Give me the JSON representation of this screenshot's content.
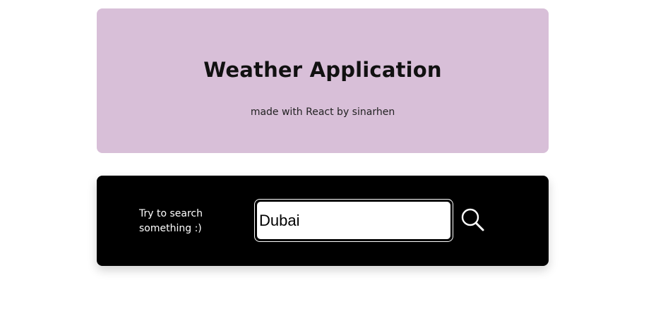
{
  "header": {
    "title": "Weather Application",
    "subtitle": "made with React by sinarhen",
    "background_color": "#d8bfd8"
  },
  "search": {
    "hint": "Try to search something :)",
    "input_value": "Dubai",
    "button_icon": "search-icon",
    "background_color": "#000000"
  }
}
